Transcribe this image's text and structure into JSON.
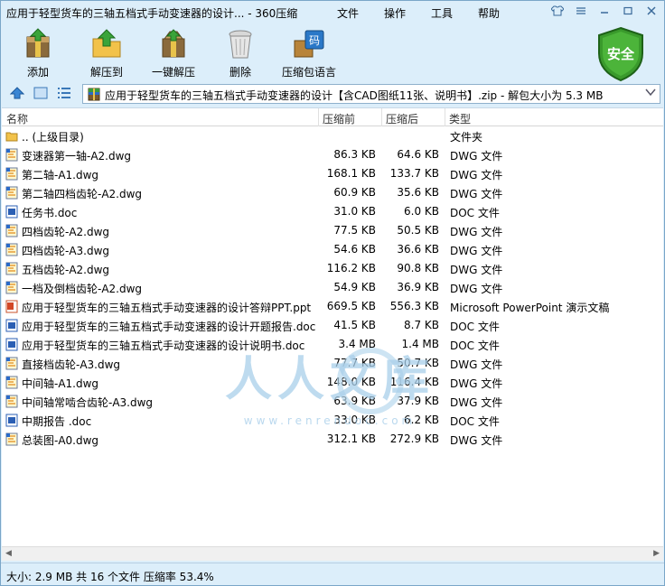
{
  "window": {
    "title": "应用于轻型货车的三轴五档式手动变速器的设计... - 360压缩",
    "menu": [
      "文件",
      "操作",
      "工具",
      "帮助"
    ]
  },
  "toolbar": {
    "add": "添加",
    "extract_to": "解压到",
    "one_click": "一键解压",
    "delete": "删除",
    "language": "压缩包语言",
    "language_badge": "码",
    "safe": "安全"
  },
  "address": {
    "value": "应用于轻型货车的三轴五档式手动变速器的设计【含CAD图纸11张、说明书】.zip - 解包大小为 5.3 MB"
  },
  "columns": {
    "name": "名称",
    "size": "压缩前",
    "packed": "压缩后",
    "type": "类型"
  },
  "files": [
    {
      "name": ".. (上级目录)",
      "size": "",
      "packed": "",
      "type": "文件夹",
      "icon": "folder"
    },
    {
      "name": "变速器第一轴-A2.dwg",
      "size": "86.3 KB",
      "packed": "64.6 KB",
      "type": "DWG 文件",
      "icon": "dwg"
    },
    {
      "name": "第二轴-A1.dwg",
      "size": "168.1 KB",
      "packed": "133.7 KB",
      "type": "DWG 文件",
      "icon": "dwg"
    },
    {
      "name": "第二轴四档齿轮-A2.dwg",
      "size": "60.9 KB",
      "packed": "35.6 KB",
      "type": "DWG 文件",
      "icon": "dwg"
    },
    {
      "name": "任务书.doc",
      "size": "31.0 KB",
      "packed": "6.0 KB",
      "type": "DOC 文件",
      "icon": "doc"
    },
    {
      "name": "四档齿轮-A2.dwg",
      "size": "77.5 KB",
      "packed": "50.5 KB",
      "type": "DWG 文件",
      "icon": "dwg"
    },
    {
      "name": "四档齿轮-A3.dwg",
      "size": "54.6 KB",
      "packed": "36.6 KB",
      "type": "DWG 文件",
      "icon": "dwg"
    },
    {
      "name": "五档齿轮-A2.dwg",
      "size": "116.2 KB",
      "packed": "90.8 KB",
      "type": "DWG 文件",
      "icon": "dwg"
    },
    {
      "name": "一档及倒档齿轮-A2.dwg",
      "size": "54.9 KB",
      "packed": "36.9 KB",
      "type": "DWG 文件",
      "icon": "dwg"
    },
    {
      "name": "应用于轻型货车的三轴五档式手动变速器的设计答辩PPT.ppt",
      "size": "669.5 KB",
      "packed": "556.3 KB",
      "type": "Microsoft PowerPoint 演示文稿",
      "icon": "ppt"
    },
    {
      "name": "应用于轻型货车的三轴五档式手动变速器的设计开题报告.doc",
      "size": "41.5 KB",
      "packed": "8.7 KB",
      "type": "DOC 文件",
      "icon": "doc"
    },
    {
      "name": "应用于轻型货车的三轴五档式手动变速器的设计说明书.doc",
      "size": "3.4 MB",
      "packed": "1.4 MB",
      "type": "DOC 文件",
      "icon": "doc"
    },
    {
      "name": "直接档齿轮-A3.dwg",
      "size": "77.7 KB",
      "packed": "50.7 KB",
      "type": "DWG 文件",
      "icon": "dwg"
    },
    {
      "name": "中间轴-A1.dwg",
      "size": "148.0 KB",
      "packed": "116.4 KB",
      "type": "DWG 文件",
      "icon": "dwg"
    },
    {
      "name": "中间轴常啮合齿轮-A3.dwg",
      "size": "63.9 KB",
      "packed": "37.9 KB",
      "type": "DWG 文件",
      "icon": "dwg"
    },
    {
      "name": "中期报告 .doc",
      "size": "33.0 KB",
      "packed": "6.2 KB",
      "type": "DOC 文件",
      "icon": "doc"
    },
    {
      "name": "总装图-A0.dwg",
      "size": "312.1 KB",
      "packed": "272.9 KB",
      "type": "DWG 文件",
      "icon": "dwg"
    }
  ],
  "status": {
    "text": "大小: 2.9 MB 共 16 个文件 压缩率 53.4%"
  },
  "watermark": {
    "main": "人人文库",
    "url": "www.renrendoc.com"
  },
  "colors": {
    "accent": "#dceefa",
    "safe_green": "#3a9a2c",
    "folder": "#f2c24a",
    "doc_blue": "#2b5fb4"
  }
}
